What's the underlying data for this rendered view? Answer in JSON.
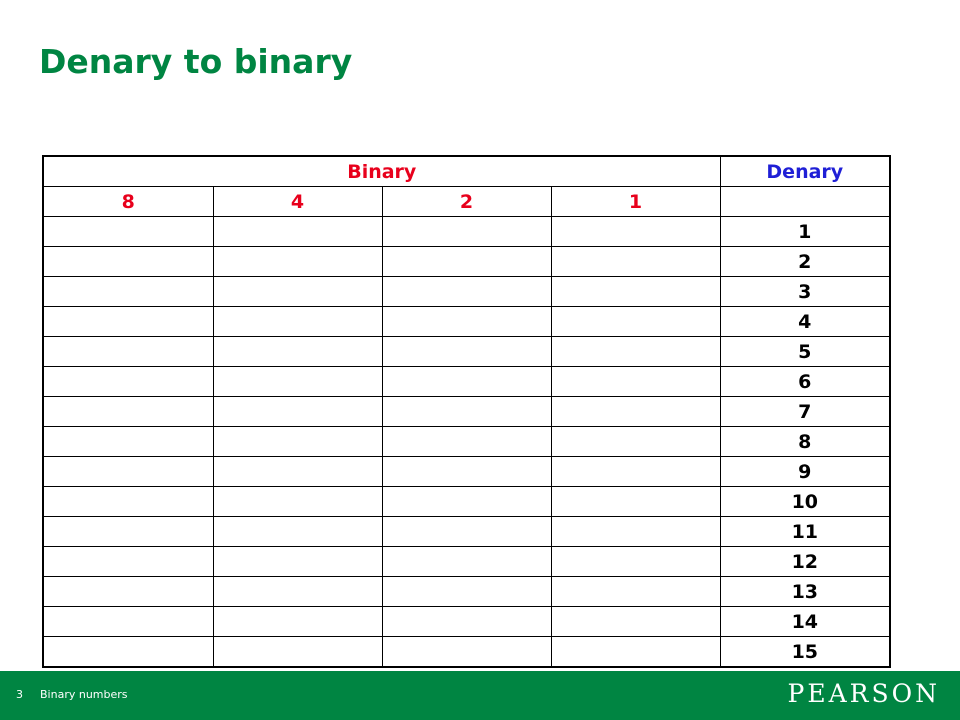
{
  "slide": {
    "title": "Denary to binary"
  },
  "table": {
    "group_headers": {
      "binary": "Binary",
      "denary": "Denary"
    },
    "place_values": [
      "8",
      "4",
      "2",
      "1"
    ],
    "denary_values": [
      "1",
      "2",
      "3",
      "4",
      "5",
      "6",
      "7",
      "8",
      "9",
      "10",
      "11",
      "12",
      "13",
      "14",
      "15"
    ]
  },
  "footer": {
    "slide_number": "3",
    "text": "Binary numbers",
    "brand": "PEARSON"
  },
  "colors": {
    "title_green": "#008542",
    "binary_red": "#e8001c",
    "denary_blue": "#1f1fd6",
    "footer_green": "#008542"
  }
}
